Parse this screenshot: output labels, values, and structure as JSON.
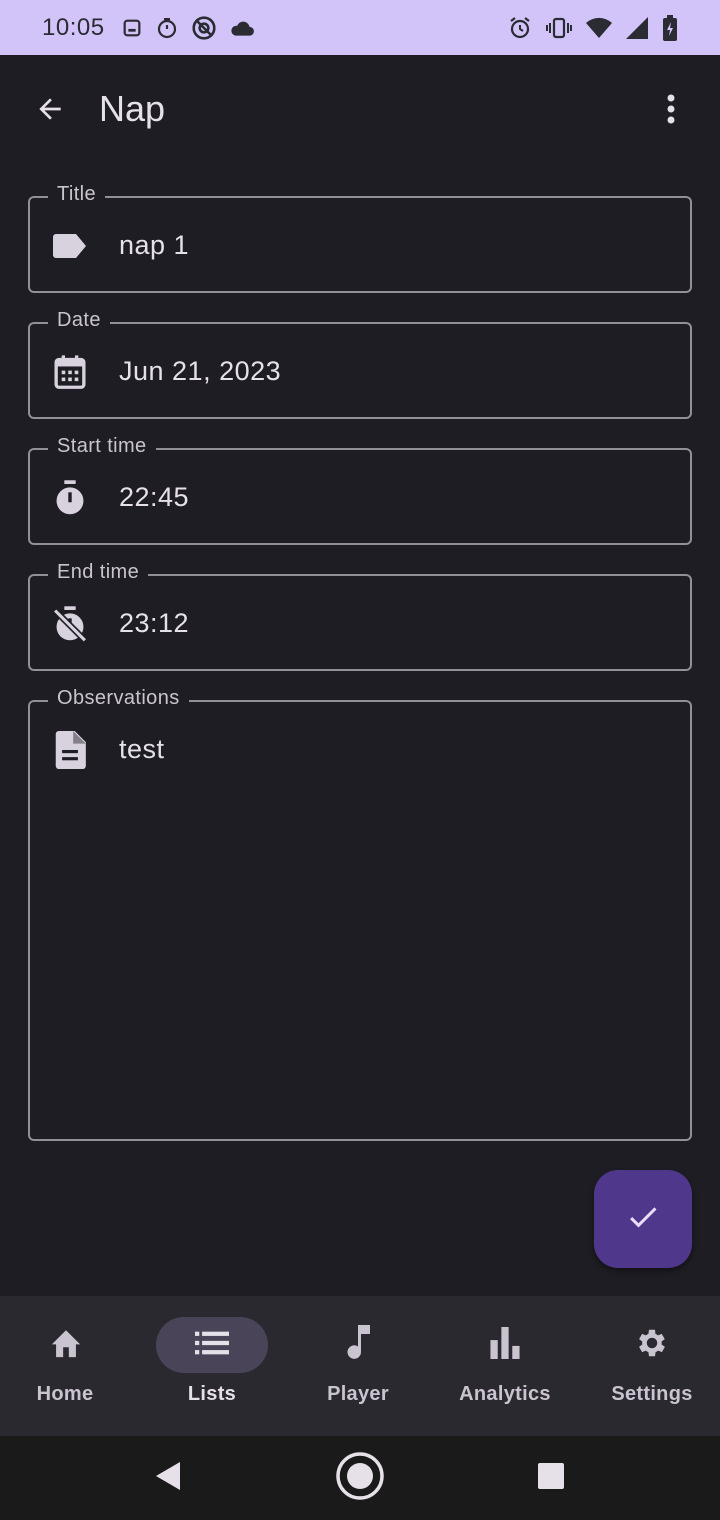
{
  "status_bar": {
    "time": "10:05",
    "left_icons": [
      "sim-card-icon",
      "timer-icon",
      "at-sign-icon",
      "cloud-icon"
    ],
    "right_icons": [
      "alarm-icon",
      "vibrate-icon",
      "wifi-icon",
      "signal-icon",
      "battery-icon"
    ],
    "background": "#d2c4f9"
  },
  "app_bar": {
    "title": "Nap",
    "back_icon": "arrow-back-icon",
    "menu_icon": "more-vert-icon"
  },
  "fields": {
    "title": {
      "label": "Title",
      "value": "nap 1",
      "icon": "label-tag-icon"
    },
    "date": {
      "label": "Date",
      "value": "Jun 21, 2023",
      "icon": "calendar-icon"
    },
    "start_time": {
      "label": "Start time",
      "value": "22:45",
      "icon": "timer-icon"
    },
    "end_time": {
      "label": "End time",
      "value": "23:12",
      "icon": "timer-off-icon"
    },
    "observations": {
      "label": "Observations",
      "value": "test",
      "icon": "document-icon"
    }
  },
  "fab": {
    "icon": "check-icon",
    "color": "#4f378b"
  },
  "bottom_nav": {
    "items": [
      {
        "label": "Home",
        "icon": "home-icon"
      },
      {
        "label": "Lists",
        "icon": "list-icon",
        "active": true
      },
      {
        "label": "Player",
        "icon": "music-note-icon"
      },
      {
        "label": "Analytics",
        "icon": "bar-chart-icon"
      },
      {
        "label": "Settings",
        "icon": "gear-icon"
      }
    ]
  },
  "system_nav": {
    "buttons": [
      "back-triangle-icon",
      "home-circle-icon",
      "recents-square-icon"
    ]
  },
  "colors": {
    "background": "#1e1d23",
    "outline": "#938f99",
    "nav_background": "#2b2930",
    "active_indicator": "#4a4458"
  }
}
